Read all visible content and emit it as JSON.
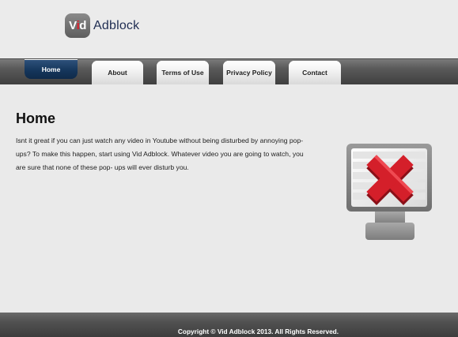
{
  "logo": {
    "badge_v": "V",
    "badge_i": "i",
    "badge_d": "d",
    "word": "Adblock"
  },
  "nav": {
    "items": [
      {
        "label": "Home",
        "active": true
      },
      {
        "label": "About",
        "active": false
      },
      {
        "label": "Terms of Use",
        "active": false
      },
      {
        "label": "Privacy Policy",
        "active": false
      },
      {
        "label": "Contact",
        "active": false
      }
    ]
  },
  "main": {
    "title": "Home",
    "text": "Isnt it great if you can just watch any video in Youtube without being disturbed by annoying pop- ups? To make this happen, start using Vid Adblock. Whatever video you are going to watch, you are sure that none of these pop- ups will ever disturb you."
  },
  "illustration": {
    "icon": "monitor-with-red-x-icon",
    "accent": "#d41f2a"
  },
  "footer": {
    "text": "Copyright © Vid Adblock 2013. All Rights Reserved."
  },
  "colors": {
    "nav_active": "#14355a",
    "brand_text": "#1f2d52",
    "brand_red": "#e01e2c"
  }
}
